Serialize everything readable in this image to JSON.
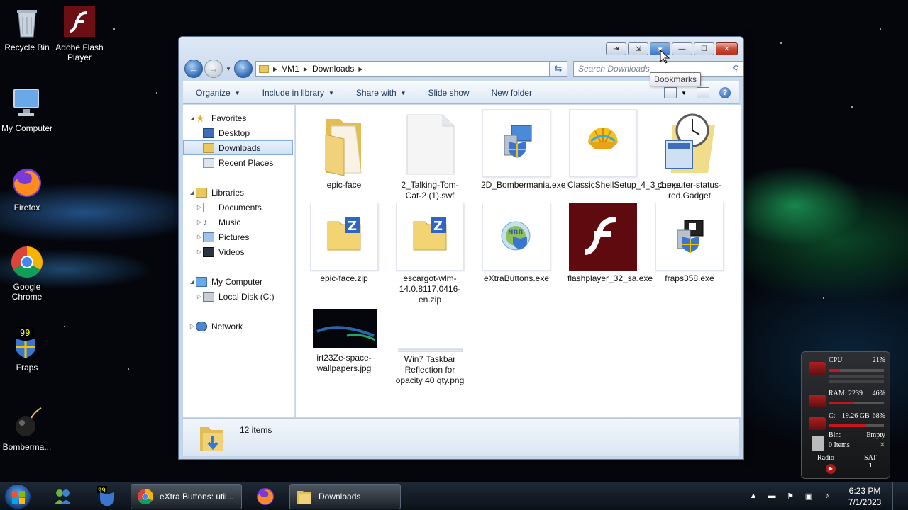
{
  "desktop": {
    "icons": [
      {
        "label": "Recycle Bin"
      },
      {
        "label": "Adobe Flash Player"
      },
      {
        "label": "My Computer"
      },
      {
        "label": "Firefox"
      },
      {
        "label": "Google Chrome"
      },
      {
        "label": "Fraps"
      },
      {
        "label": "Bomberma..."
      }
    ]
  },
  "window": {
    "buttons": [
      "⇥",
      "⇲",
      "★",
      "—",
      "☐",
      "✕"
    ],
    "address": {
      "crumbs": [
        "VM1",
        "Downloads"
      ]
    },
    "search": {
      "placeholder": "Search Downloads"
    },
    "tooltip": "Bookmarks",
    "toolbar": {
      "organize": "Organize",
      "include": "Include in library",
      "share": "Share with",
      "slideshow": "Slide show",
      "newfolder": "New folder"
    },
    "nav": {
      "favorites": "Favorites",
      "desktop": "Desktop",
      "downloads": "Downloads",
      "recent": "Recent Places",
      "libraries": "Libraries",
      "documents": "Documents",
      "music": "Music",
      "pictures": "Pictures",
      "videos": "Videos",
      "mycomputer": "My Computer",
      "localdisk": "Local Disk (C:)",
      "network": "Network"
    },
    "files": [
      {
        "name": "epic-face"
      },
      {
        "name": "2_Talking-Tom-Cat-2 (1).swf"
      },
      {
        "name": "2D_Bombermania.exe"
      },
      {
        "name": "ClassicShellSetup_4_3_1.exe"
      },
      {
        "name": "computer-status-red.Gadget"
      },
      {
        "name": "epic-face.zip"
      },
      {
        "name": "escargot-wlm-14.0.8117.0416-en.zip"
      },
      {
        "name": "eXtraButtons.exe"
      },
      {
        "name": "flashplayer_32_sa.exe"
      },
      {
        "name": "fraps358.exe"
      },
      {
        "name": "irt23Ze-space-wallpapers.jpg"
      },
      {
        "name": "Win7 Taskbar Reflection for opacity 40 qty.png"
      }
    ],
    "status": {
      "count": "12 items"
    }
  },
  "taskbar": {
    "tasks": [
      {
        "label": "eXtra Buttons: util..."
      },
      {
        "label": "Downloads"
      }
    ],
    "clock": {
      "time": "6:23 PM",
      "date": "7/1/2023"
    }
  },
  "gadget": {
    "cpu_label": "CPU",
    "cpu_value": "21%",
    "cpu_level": 0.21,
    "ram_label": "RAM: 2239",
    "ram_value": "46%",
    "ram_level": 0.46,
    "disk_label": "C:",
    "disk_size": "19.26 GB",
    "disk_value": "68%",
    "disk_level": 0.68,
    "bin_label": "Bin:",
    "bin_status": "Empty",
    "bin_items": "0 Items",
    "radio_label": "Radio",
    "day": "SAT",
    "date_num": "1"
  },
  "colors": {
    "accent": "#2f6bb5",
    "close": "#c74a35",
    "gadget_red": "#c8151b"
  }
}
